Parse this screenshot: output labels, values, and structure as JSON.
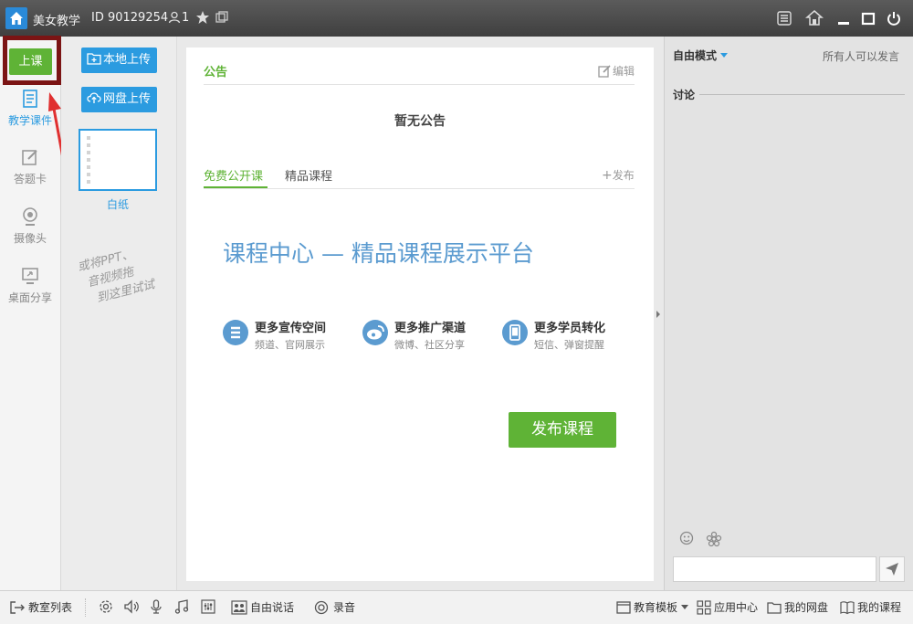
{
  "titlebar": {
    "app_name": "美女教学",
    "room_id": "ID 90129254",
    "user_count": "1"
  },
  "leftnav": {
    "start_class": "上课",
    "items": [
      {
        "label": "教学课件"
      },
      {
        "label": "答题卡"
      },
      {
        "label": "摄像头"
      },
      {
        "label": "桌面分享"
      }
    ]
  },
  "thumbs": {
    "local_upload": "本地上传",
    "cloud_upload": "网盘上传",
    "blank_label": "白纸",
    "drag_hint_1": "或将PPT、",
    "drag_hint_2": "音视频拖",
    "drag_hint_3": "到这里试试"
  },
  "notice": {
    "title": "公告",
    "edit": "编辑",
    "empty": "暂无公告"
  },
  "courses": {
    "tabs": [
      "免费公开课",
      "精品课程"
    ],
    "publish_link": "发布",
    "headline": "课程中心 — 精品课程展示平台",
    "features": [
      {
        "title": "更多宣传空间",
        "sub": "频道、官网展示"
      },
      {
        "title": "更多推广渠道",
        "sub": "微博、社区分享"
      },
      {
        "title": "更多学员转化",
        "sub": "短信、弹窗提醒"
      }
    ],
    "publish_button": "发布课程"
  },
  "right": {
    "mode": "自由模式",
    "permission": "所有人可以发言",
    "discussion": "讨论"
  },
  "bottombar": {
    "room_list": "教室列表",
    "free_talk": "自由说话",
    "record": "录音",
    "template": "教育模板",
    "app_center": "应用中心",
    "my_disk": "我的网盘",
    "my_courses": "我的课程"
  },
  "colors": {
    "green": "#5fb336",
    "blue": "#2b9be0",
    "highlight": "#7b1414",
    "arrow": "#e03030"
  }
}
